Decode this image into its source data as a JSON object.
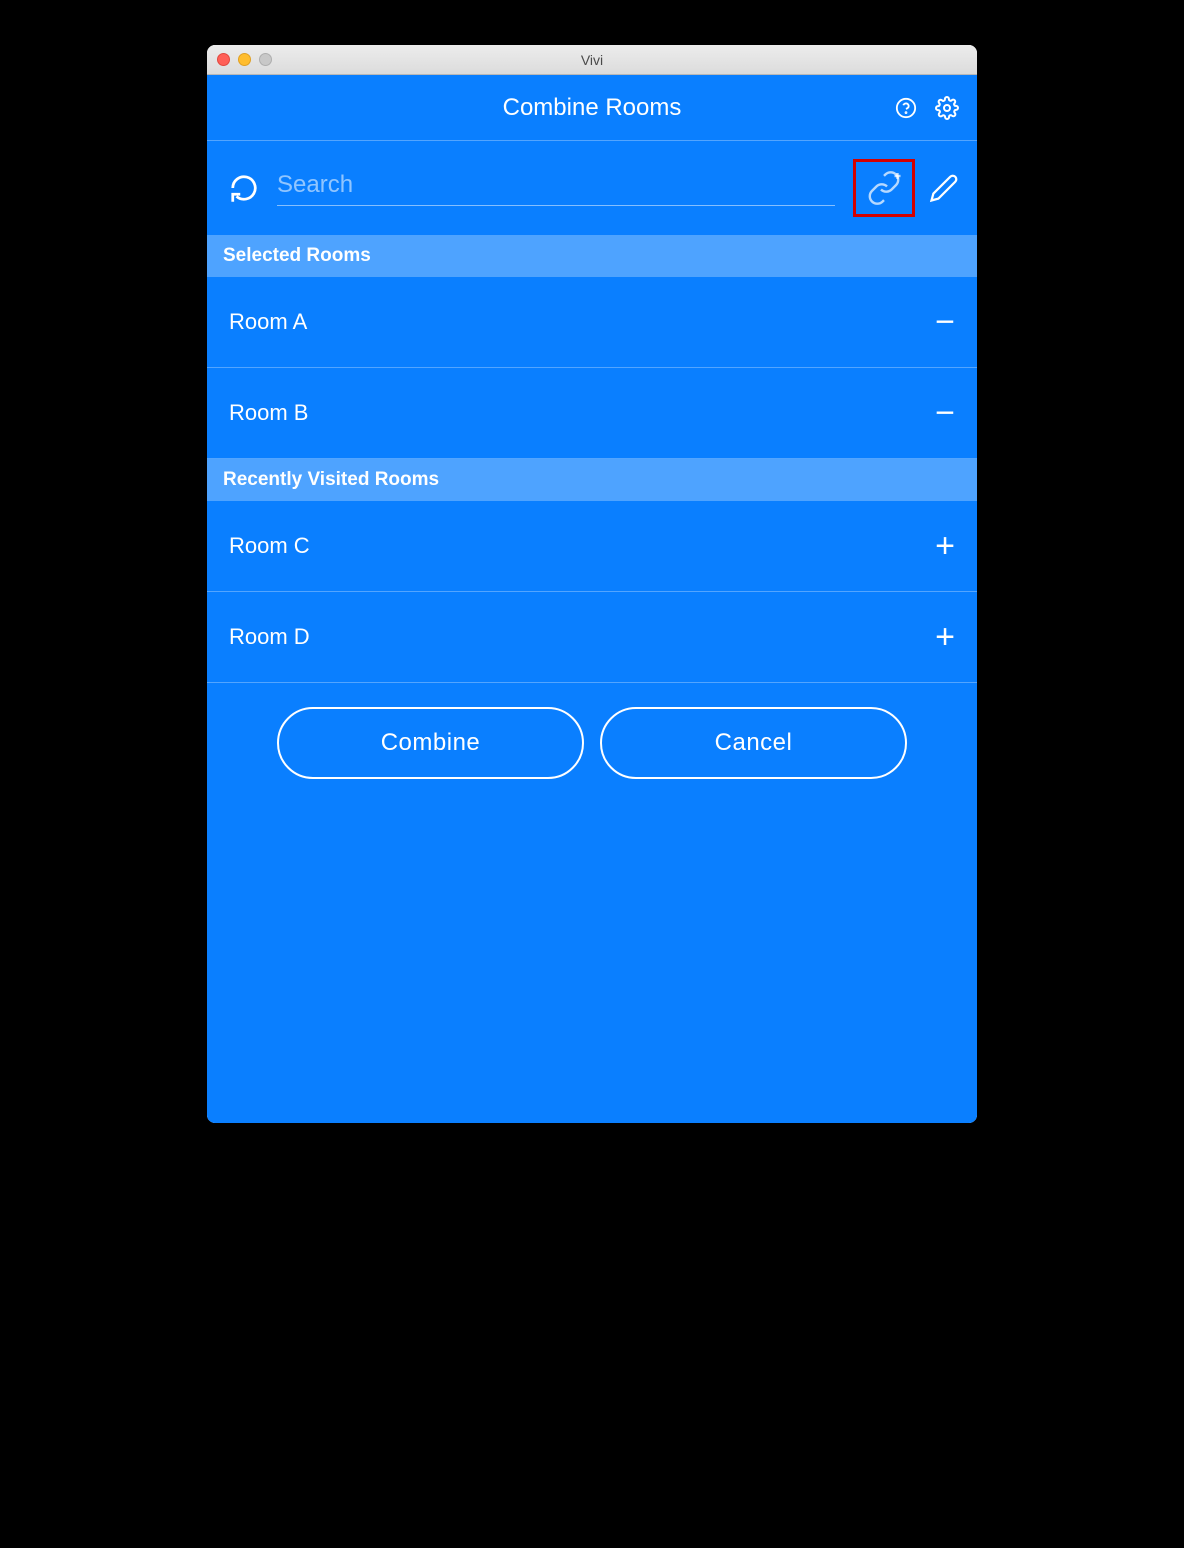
{
  "window": {
    "title": "Vivi"
  },
  "header": {
    "title": "Combine Rooms"
  },
  "search": {
    "placeholder": "Search"
  },
  "sections": {
    "selected": {
      "title": "Selected Rooms",
      "rooms": [
        {
          "name": "Room A"
        },
        {
          "name": "Room B"
        }
      ]
    },
    "recent": {
      "title": "Recently Visited Rooms",
      "rooms": [
        {
          "name": "Room C"
        },
        {
          "name": "Room D"
        }
      ]
    }
  },
  "buttons": {
    "combine": "Combine",
    "cancel": "Cancel"
  }
}
